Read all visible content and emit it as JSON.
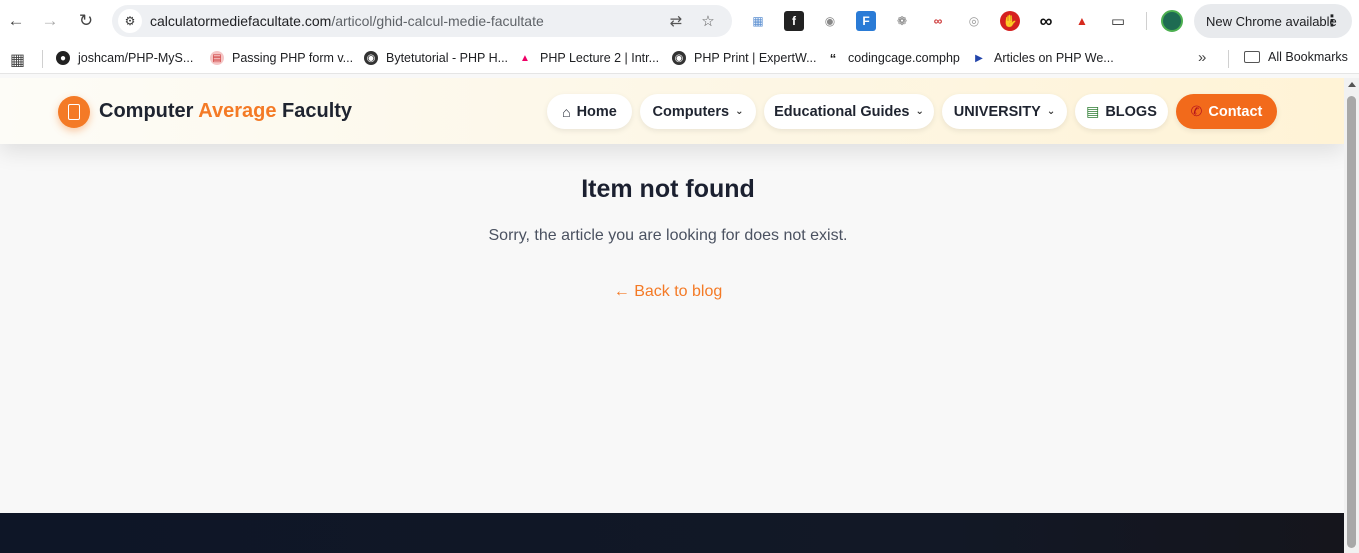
{
  "browser": {
    "url_host": "calculatormediefacultate.com",
    "url_path": "/articol/ghid-calcul-medie-facultate",
    "update_label": "New Chrome available",
    "bookmarks": [
      "joshcam/PHP-MyS...",
      "Passing PHP form v...",
      "Bytetutorial - PHP H...",
      "PHP Lecture 2 | Intr...",
      "PHP Print | ExpertW...",
      "codingcage.comphp",
      "Articles on PHP We..."
    ],
    "all_bookmarks_label": "All Bookmarks"
  },
  "site": {
    "brand_part1": "Computer ",
    "brand_accent": "Average",
    "brand_part2": " Faculty",
    "nav": {
      "home": "Home",
      "computers": "Computers",
      "guides": "Educational Guides",
      "university": "UNIVERSITY",
      "blogs": "BLOGS",
      "contact": "Contact"
    }
  },
  "main": {
    "title": "Item not found",
    "message": "Sorry, the article you are looking for does not exist.",
    "back_link": "← Back to blog"
  },
  "colors": {
    "accent": "#f47a26",
    "footer": "#121826"
  }
}
